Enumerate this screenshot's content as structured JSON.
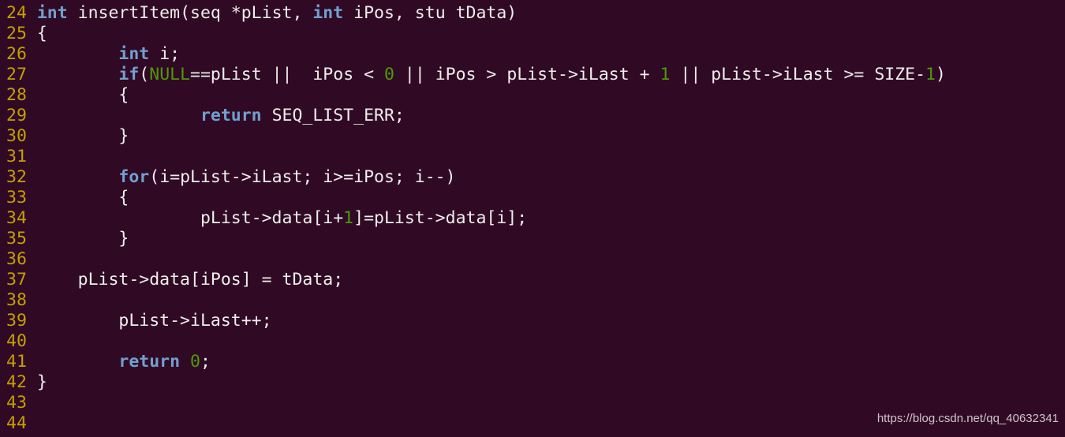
{
  "editor": {
    "colors": {
      "background": "#300a24",
      "line_number": "#c4a000",
      "keyword": "#729fcf",
      "constant": "#4e9a06",
      "text": "#eeeeec"
    },
    "lines": [
      {
        "num": "24",
        "tokens": [
          {
            "c": "kw",
            "t": "int"
          },
          {
            "c": "txt",
            "t": " insertItem(seq *pList, "
          },
          {
            "c": "kw",
            "t": "int"
          },
          {
            "c": "txt",
            "t": " iPos, stu tData)"
          }
        ]
      },
      {
        "num": "25",
        "tokens": [
          {
            "c": "txt",
            "t": "{"
          }
        ]
      },
      {
        "num": "26",
        "tokens": [
          {
            "c": "txt",
            "t": "        "
          },
          {
            "c": "kw",
            "t": "int"
          },
          {
            "c": "txt",
            "t": " i;"
          }
        ]
      },
      {
        "num": "27",
        "tokens": [
          {
            "c": "txt",
            "t": "        "
          },
          {
            "c": "kw",
            "t": "if"
          },
          {
            "c": "txt",
            "t": "("
          },
          {
            "c": "const",
            "t": "NULL"
          },
          {
            "c": "txt",
            "t": "==pList ||  iPos < "
          },
          {
            "c": "const",
            "t": "0"
          },
          {
            "c": "txt",
            "t": " || iPos > pList->iLast + "
          },
          {
            "c": "const",
            "t": "1"
          },
          {
            "c": "txt",
            "t": " || pList->iLast >= SIZE-"
          },
          {
            "c": "const",
            "t": "1"
          },
          {
            "c": "txt",
            "t": ")"
          }
        ]
      },
      {
        "num": "28",
        "tokens": [
          {
            "c": "txt",
            "t": "        {"
          }
        ]
      },
      {
        "num": "29",
        "tokens": [
          {
            "c": "txt",
            "t": "                "
          },
          {
            "c": "kw",
            "t": "return"
          },
          {
            "c": "txt",
            "t": " SEQ_LIST_ERR;"
          }
        ]
      },
      {
        "num": "30",
        "tokens": [
          {
            "c": "txt",
            "t": "        }"
          }
        ]
      },
      {
        "num": "31",
        "tokens": []
      },
      {
        "num": "32",
        "tokens": [
          {
            "c": "txt",
            "t": "        "
          },
          {
            "c": "kw",
            "t": "for"
          },
          {
            "c": "txt",
            "t": "(i=pList->iLast; i>=iPos; i--)"
          }
        ]
      },
      {
        "num": "33",
        "tokens": [
          {
            "c": "txt",
            "t": "        {"
          }
        ]
      },
      {
        "num": "34",
        "tokens": [
          {
            "c": "txt",
            "t": "                pList->data[i+"
          },
          {
            "c": "const",
            "t": "1"
          },
          {
            "c": "txt",
            "t": "]=pList->data[i];"
          }
        ]
      },
      {
        "num": "35",
        "tokens": [
          {
            "c": "txt",
            "t": "        }"
          }
        ]
      },
      {
        "num": "36",
        "tokens": []
      },
      {
        "num": "37",
        "tokens": [
          {
            "c": "txt",
            "t": "    pList->data[iPos] = tData;"
          }
        ]
      },
      {
        "num": "38",
        "tokens": []
      },
      {
        "num": "39",
        "tokens": [
          {
            "c": "txt",
            "t": "        pList->iLast++;"
          }
        ]
      },
      {
        "num": "40",
        "tokens": []
      },
      {
        "num": "41",
        "tokens": [
          {
            "c": "txt",
            "t": "        "
          },
          {
            "c": "kw",
            "t": "return"
          },
          {
            "c": "txt",
            "t": " "
          },
          {
            "c": "const",
            "t": "0"
          },
          {
            "c": "txt",
            "t": ";"
          }
        ]
      },
      {
        "num": "42",
        "tokens": [
          {
            "c": "txt",
            "t": "}"
          }
        ]
      },
      {
        "num": "43",
        "tokens": []
      },
      {
        "num": "44",
        "tokens": []
      }
    ]
  },
  "watermark": "https://blog.csdn.net/qq_40632341"
}
